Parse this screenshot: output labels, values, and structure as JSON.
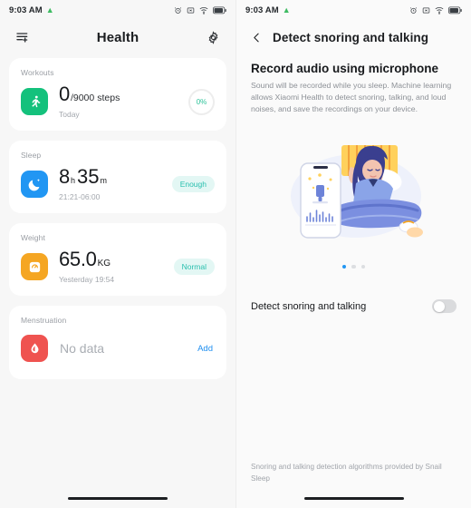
{
  "left": {
    "status": {
      "time": "9:03 AM",
      "leaf_icon": "leaf-icon",
      "icons": [
        "alarm-icon",
        "mute-icon",
        "wifi-icon",
        "battery-icon"
      ],
      "battery_level": "85"
    },
    "header": {
      "menu_icon": "list-add-icon",
      "title": "Health",
      "settings_icon": "gear-icon"
    },
    "cards": [
      {
        "id": "workouts",
        "title": "Workouts",
        "icon": "running-icon",
        "icon_color": "#14c17c",
        "value": "0",
        "value_suffix": "/9000",
        "unit": "steps",
        "meta": "Today",
        "trailing_type": "ring",
        "trailing_text": "0%",
        "trailing_color": "#2fc39a"
      },
      {
        "id": "sleep",
        "title": "Sleep",
        "icon": "moon-icon",
        "icon_color": "#2196f3",
        "value": "8",
        "unit": "h",
        "value2": "35",
        "unit2": "m",
        "meta": "21:21-06:00",
        "trailing_type": "badge",
        "trailing_text": "Enough",
        "trailing_color": "#28bfae"
      },
      {
        "id": "weight",
        "title": "Weight",
        "icon": "scale-icon",
        "icon_color": "#f5a623",
        "value": "65.0",
        "unit": "KG",
        "meta": "Yesterday 19:54",
        "trailing_type": "badge",
        "trailing_text": "Normal",
        "trailing_color": "#28bfae"
      },
      {
        "id": "menstruation",
        "title": "Menstruation",
        "icon": "droplet-icon",
        "icon_color": "#ef5350",
        "empty_text": "No data",
        "trailing_type": "link",
        "trailing_text": "Add",
        "trailing_color": "#1f8ff0"
      }
    ]
  },
  "right": {
    "status": {
      "time": "9:03 AM",
      "leaf_icon": "leaf-icon",
      "icons": [
        "alarm-icon",
        "mute-icon",
        "wifi-icon",
        "battery-icon"
      ],
      "battery_level": "85"
    },
    "header": {
      "back_icon": "chevron-left-icon",
      "title": "Detect snoring and talking"
    },
    "section": {
      "heading": "Record audio using microphone",
      "body": "Sound will be recorded while you sleep. Machine learning allows Xiaomi Health to detect snoring, talking, and loud noises, and save the recordings on your device."
    },
    "illustration": {
      "name": "sleeping-person-with-phone-illustration",
      "colors": {
        "background": "#eef1fb",
        "headboard": "#ffd15c",
        "blanket": "#7b8fe0",
        "shirt": "#8aa4e8",
        "hair": "#3a3f8f",
        "skin": "#f2c4b0",
        "phone": "#ffffff"
      }
    },
    "carousel": {
      "total_dots": 3,
      "active_index": 0
    },
    "toggle": {
      "label": "Detect snoring and talking",
      "enabled": false
    },
    "footer": "Snoring and talking detection algorithms provided by Snail Sleep"
  }
}
